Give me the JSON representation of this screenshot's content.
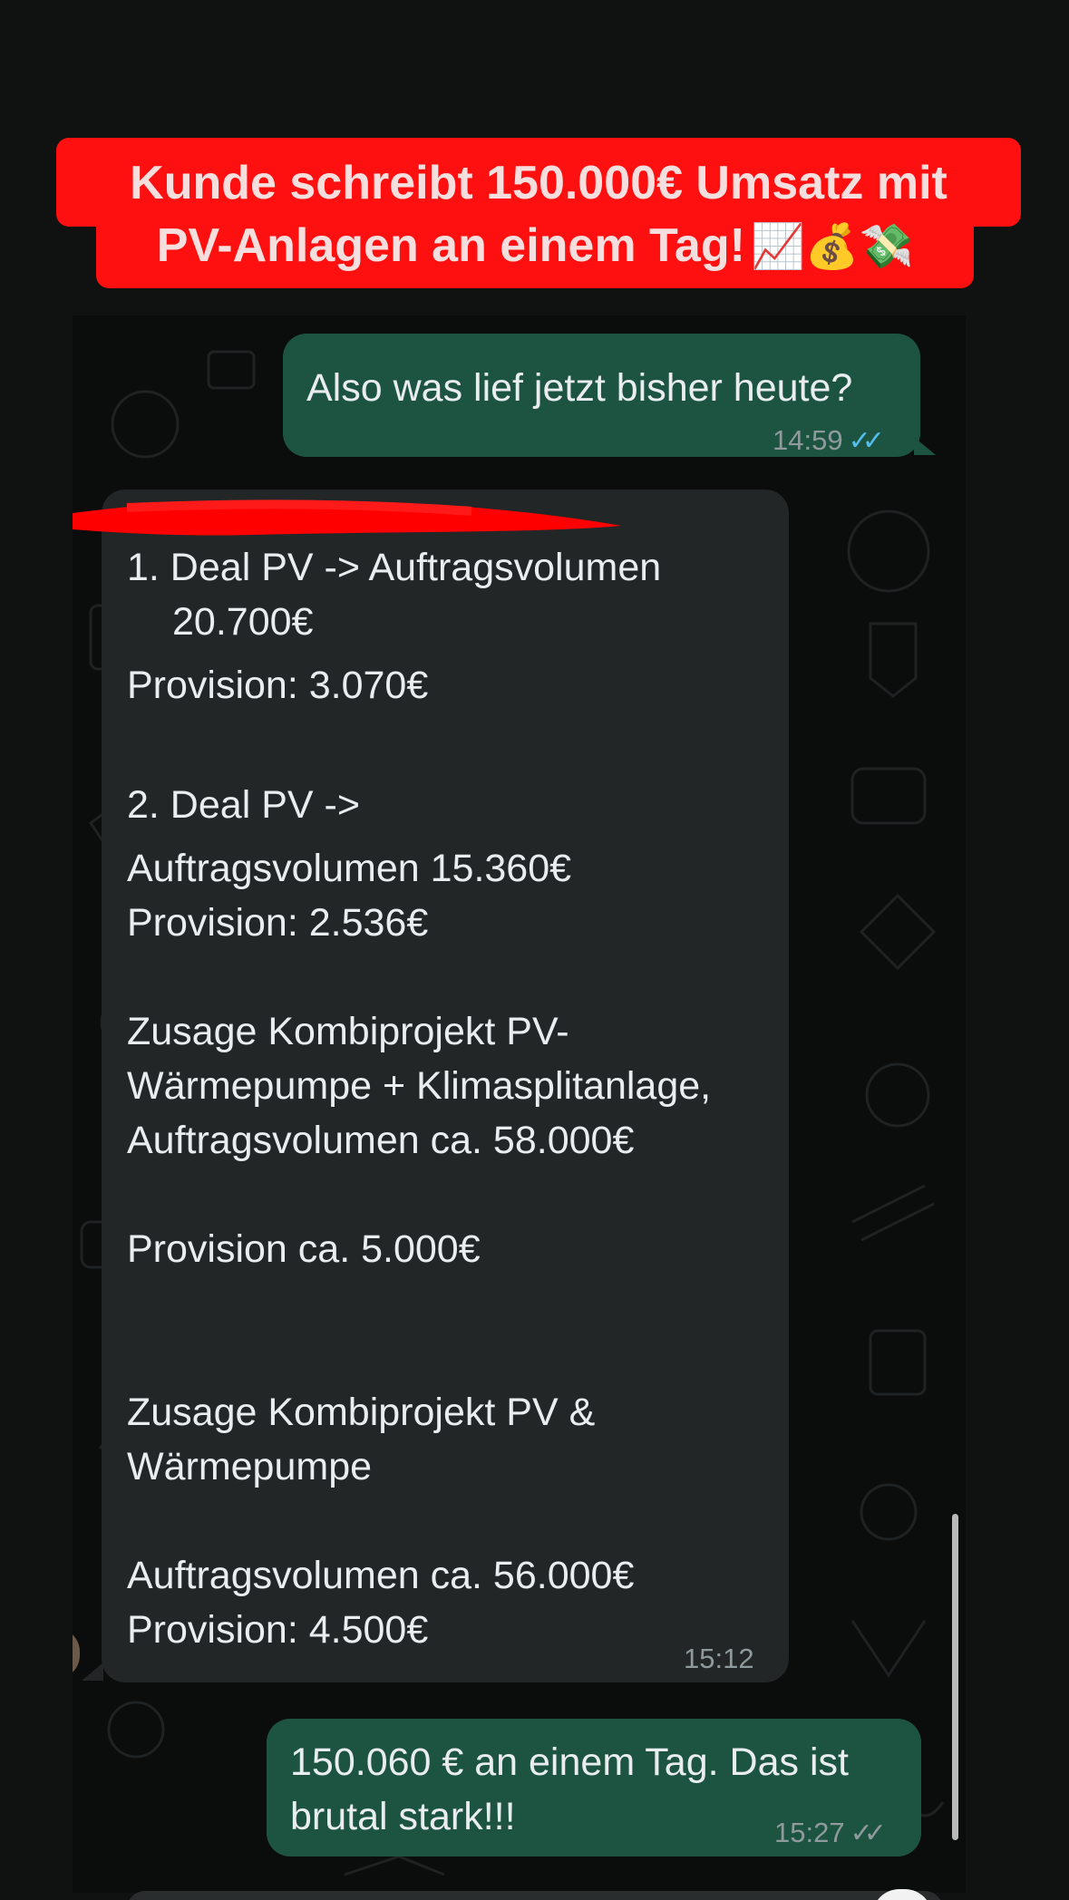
{
  "banner": {
    "line1": "Kunde schreibt 150.000€ Umsatz mit",
    "line2": "PV-Anlagen an einem Tag!",
    "emojis": "📈💰💸"
  },
  "messages": [
    {
      "direction": "outgoing",
      "text": "Also was lief jetzt bisher heute?",
      "time": "14:59",
      "ticks": "✓✓",
      "status": "read"
    },
    {
      "direction": "incoming",
      "sender_redacted": true,
      "lines": [
        "1. Deal PV -> Auftragsvolumen",
        "20.700€",
        "Provision: 3.070€",
        "2. Deal PV ->",
        "Auftragsvolumen 15.360€",
        "Provision: 2.536€",
        "Zusage Kombiprojekt PV-",
        "Wärmepumpe + Klimasplitanlage,",
        "Auftragsvolumen ca. 58.000€",
        "Provision ca. 5.000€",
        "Zusage Kombiprojekt PV &",
        "Wärmepumpe",
        "Auftragsvolumen ca. 56.000€",
        "Provision: 4.500€"
      ],
      "time": "15:12"
    },
    {
      "direction": "outgoing",
      "lines": [
        "150.060 € an einem Tag. Das ist",
        "brutal stark!!!"
      ],
      "time": "15:27",
      "ticks": "✓✓",
      "status": "delivered"
    }
  ],
  "colors": {
    "banner_bg": "#ff1010",
    "outgoing_bubble": "#1d5441",
    "incoming_bubble": "#232626",
    "read_ticks": "#53bdeb",
    "chat_bg": "#0b0c0c"
  }
}
